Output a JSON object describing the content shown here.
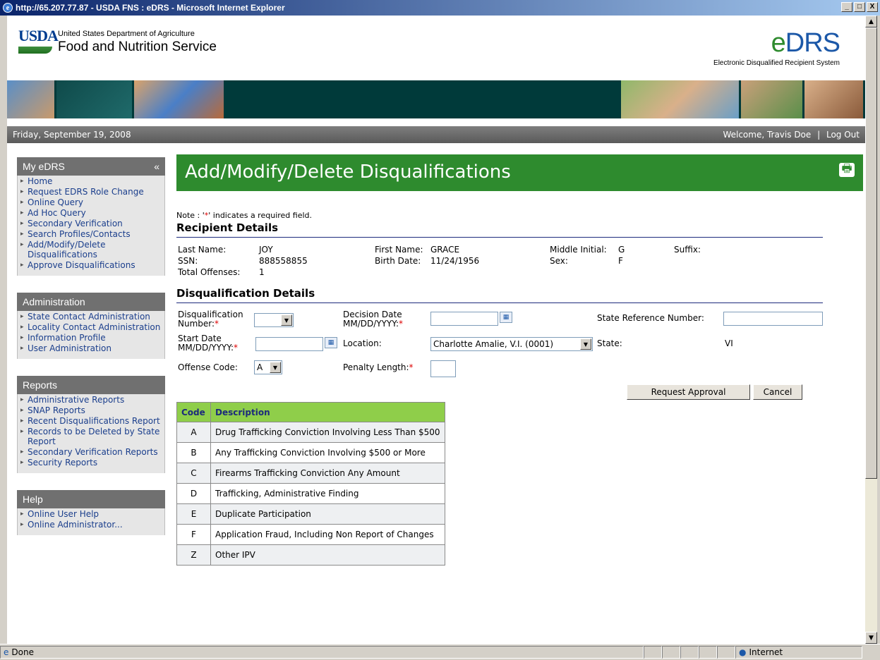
{
  "window": {
    "title": "http://65.207.77.87 - USDA FNS : eDRS - Microsoft Internet Explorer",
    "min": "_",
    "max": "□",
    "close": "X"
  },
  "header": {
    "usda": "USDA",
    "dept": "United States Department of Agriculture",
    "agency": "Food and Nutrition Service",
    "app_logo_e": "e",
    "app_logo_rest": "DRS",
    "app_subtitle": "Electronic Disqualified Recipient System"
  },
  "infobar": {
    "date": "Friday, September 19, 2008",
    "welcome": "Welcome, Travis Doe",
    "separator": "|",
    "logout": "Log Out"
  },
  "sidebar": {
    "my_edrs": {
      "title": "My eDRS",
      "collapse": "«",
      "items": [
        "Home",
        "Request EDRS Role Change",
        "Online Query",
        "Ad Hoc Query",
        "Secondary Verification",
        "Search Profiles/Contacts",
        "Add/Modify/Delete Disqualifications",
        "Approve Disqualifications"
      ]
    },
    "administration": {
      "title": "Administration",
      "items": [
        "State Contact Administration",
        "Locality Contact Administration",
        "Information Profile",
        "User Administration"
      ]
    },
    "reports": {
      "title": "Reports",
      "items": [
        "Administrative Reports",
        "SNAP Reports",
        "Recent Disqualifications Report",
        "Records to be Deleted by State Report",
        "Secondary Verification Reports",
        "Security Reports"
      ]
    },
    "help": {
      "title": "Help",
      "items": [
        "Online User Help",
        "Online Administrator..."
      ]
    }
  },
  "main": {
    "title": "Add/Modify/Delete Disqualifications",
    "note_prefix": "Note : '",
    "note_star": "*",
    "note_suffix": "' indicates a required field.",
    "recipient_title": "Recipient Details",
    "recipient": {
      "last_name_label": "Last Name:",
      "last_name": "JOY",
      "first_name_label": "First Name:",
      "first_name": "GRACE",
      "middle_label": "Middle Initial:",
      "middle": "G",
      "suffix_label": "Suffix:",
      "ssn_label": "SSN:",
      "ssn": "888558855",
      "birth_label": "Birth Date:",
      "birth": "11/24/1956",
      "sex_label": "Sex:",
      "sex": "F",
      "offenses_label": "Total Offenses:",
      "offenses": "1"
    },
    "disq_title": "Disqualification Details",
    "form": {
      "disq_number_label1": "Disqualification",
      "disq_number_label2": "Number:",
      "decision_label1": "Decision Date",
      "decision_label2": "MM/DD/YYYY:",
      "state_ref_label": "State Reference Number:",
      "start_label1": "Start Date",
      "start_label2": "MM/DD/YYYY:",
      "location_label": "Location:",
      "location_value": "Charlotte Amalie, V.I. (0001)",
      "state_label": "State:",
      "state_value": "VI",
      "offense_label": "Offense Code:",
      "offense_value": "A",
      "penalty_label": "Penalty Length:",
      "required": "*",
      "request_btn": "Request Approval",
      "cancel_btn": "Cancel"
    },
    "codes_table": {
      "headers": [
        "Code",
        "Description"
      ],
      "rows": [
        [
          "A",
          "Drug Trafficking Conviction Involving Less Than $500"
        ],
        [
          "B",
          "Any Trafficking Conviction Involving $500 or More"
        ],
        [
          "C",
          "Firearms Trafficking Conviction Any Amount"
        ],
        [
          "D",
          "Trafficking, Administrative Finding"
        ],
        [
          "E",
          "Duplicate Participation"
        ],
        [
          "F",
          "Application Fraud, Including Non Report of Changes"
        ],
        [
          "Z",
          "Other IPV"
        ]
      ]
    }
  },
  "status": {
    "text": "Done",
    "zone": "Internet"
  },
  "icons": {
    "calendar": "calendar-icon",
    "print": "printer-icon",
    "dropdown": "chevron-down-icon",
    "ie": "ie-icon",
    "globe": "globe-icon"
  }
}
